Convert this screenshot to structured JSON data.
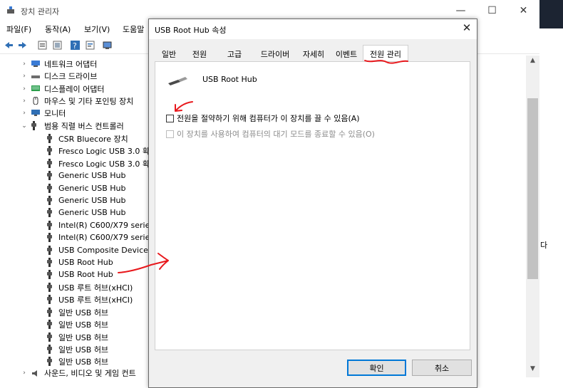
{
  "device_manager": {
    "title": "장치 관리자",
    "menu": [
      "파일(F)",
      "동작(A)",
      "보기(V)",
      "도움말"
    ],
    "tree_categories": [
      {
        "label": "네트워크 어댑터",
        "icon": "network-adapter-icon"
      },
      {
        "label": "디스크 드라이브",
        "icon": "disk-drive-icon"
      },
      {
        "label": "디스플레이 어댑터",
        "icon": "display-adapter-icon"
      },
      {
        "label": "마우스 및 기타 포인팅 장치",
        "icon": "mouse-icon"
      },
      {
        "label": "모니터",
        "icon": "monitor-icon"
      },
      {
        "label": "범용 직렬 버스 컨트롤러",
        "icon": "usb-controller-icon"
      }
    ],
    "usb_devices": [
      "CSR Bluecore 장치",
      "Fresco Logic USB 3.0 확",
      "Fresco Logic USB 3.0 확",
      "Generic USB Hub",
      "Generic USB Hub",
      "Generic USB Hub",
      "Generic USB Hub",
      "Intel(R) C600/X79 series",
      "Intel(R) C600/X79 series",
      "USB Composite Device",
      "USB Root Hub",
      "USB Root Hub",
      "USB 루트 허브(xHCI)",
      "USB 루트 허브(xHCI)",
      "일반 USB 허브",
      "일반 USB 허브",
      "일반 USB 허브",
      "일반 USB 허브",
      "일반 USB 허브"
    ],
    "bottom_cut": "사운드, 비디오 및 게임 컨트",
    "right_partial": "다"
  },
  "dialog": {
    "title": "USB Root Hub 속성",
    "tabs": [
      "일반",
      "전원",
      "고급",
      "드라이버",
      "자세히",
      "이벤트",
      "전원 관리"
    ],
    "active_tab": "전원 관리",
    "device_name": "USB Root Hub",
    "option_allow_off": {
      "label": "전원을 절약하기 위해 컴퓨터가 이 장치를 끌 수 있음(A)",
      "checked": false
    },
    "option_wake": {
      "label": "이 장치를 사용하여 컴퓨터의 대기 모드를 종료할 수 있음(O)",
      "checked": false,
      "enabled": false
    },
    "ok_label": "확인",
    "cancel_label": "취소"
  },
  "colors": {
    "annotation": "#e8181c",
    "accent": "#0078d7",
    "window_bg": "#f0f0f0"
  }
}
